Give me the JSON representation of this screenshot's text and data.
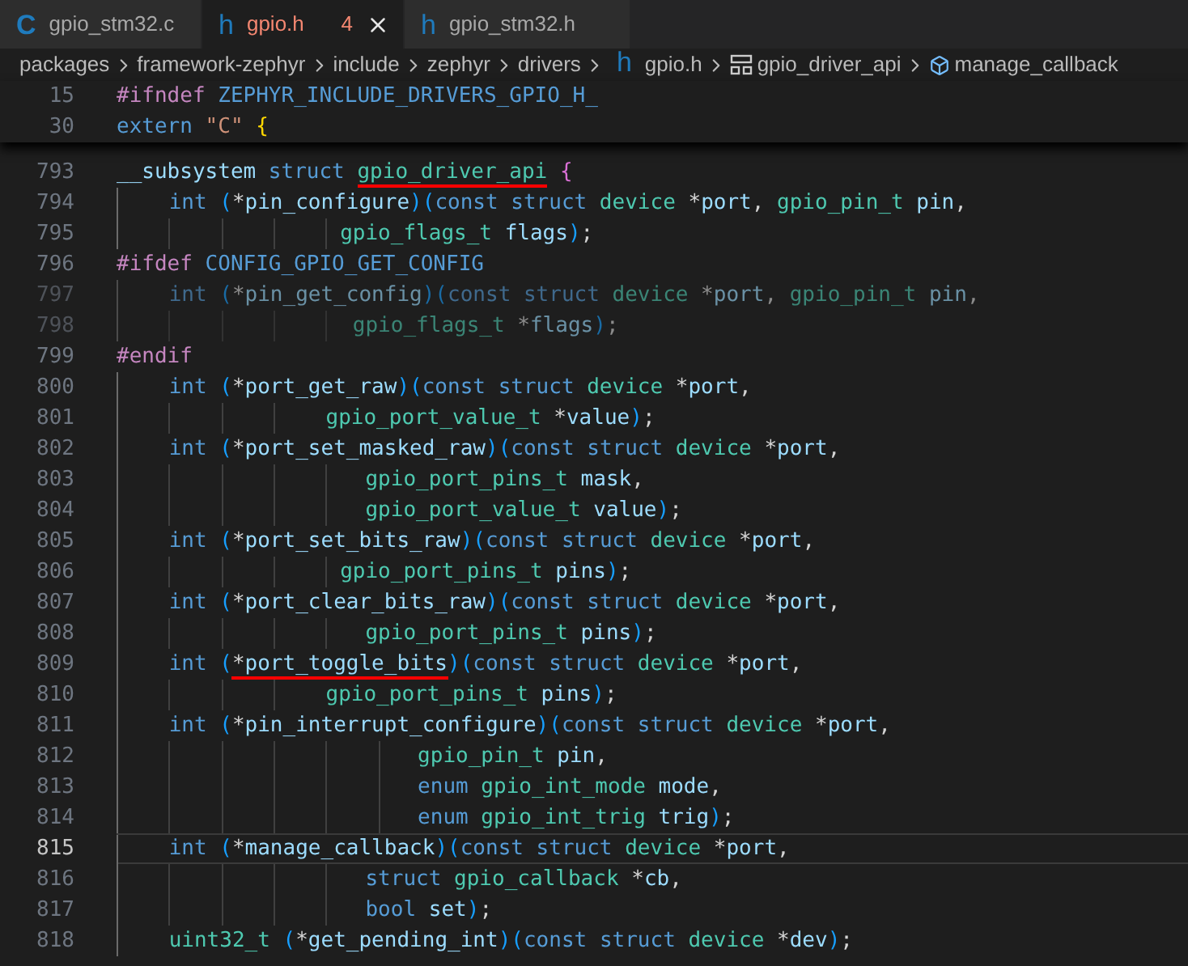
{
  "tabs": [
    {
      "glyph": "C",
      "label": "gpio_stm32.c",
      "selected": false,
      "has_errors": false
    },
    {
      "glyph": "h",
      "label": "gpio.h",
      "problems": "4",
      "selected": true,
      "has_errors": true
    },
    {
      "glyph": "h",
      "label": "gpio_stm32.h",
      "selected": false,
      "has_errors": false
    }
  ],
  "breadcrumb": [
    {
      "kind": "folder",
      "label": "packages"
    },
    {
      "kind": "folder",
      "label": "framework-zephyr"
    },
    {
      "kind": "folder",
      "label": "include"
    },
    {
      "kind": "folder",
      "label": "zephyr"
    },
    {
      "kind": "folder",
      "label": "drivers"
    },
    {
      "kind": "file",
      "glyph": "h",
      "label": "gpio.h"
    },
    {
      "kind": "struct",
      "label": "gpio_driver_api"
    },
    {
      "kind": "field",
      "label": "manage_callback"
    }
  ],
  "sticky_lines": [
    {
      "number": "15",
      "tokens": [
        {
          "text": "#ifndef",
          "kind": "pre"
        },
        {
          "text": " ZEPHYR_INCLUDE_DRIVERS_GPIO_H_",
          "kind": "macro"
        }
      ]
    },
    {
      "number": "30",
      "tokens": [
        {
          "text": "extern",
          "kind": "kw"
        },
        {
          "text": " \"C\"",
          "kind": "str"
        },
        {
          "text": " {",
          "kind": "br1"
        }
      ]
    }
  ],
  "lines": [
    {
      "number": "793",
      "current": false,
      "inactive": false,
      "tokens": [
        {
          "text": "__subsystem",
          "kind": "var"
        },
        {
          "text": " struct ",
          "kind": "kw"
        },
        {
          "text": "gpio_driver_api",
          "kind": "type",
          "underlined": true
        },
        {
          "text": " {",
          "kind": "br2"
        }
      ]
    },
    {
      "number": "794",
      "current": false,
      "inactive": false,
      "tokens": [
        {
          "text": "    int",
          "kind": "kw"
        },
        {
          "text": " (",
          "kind": "br3"
        },
        {
          "text": "*",
          "kind": "p"
        },
        {
          "text": "pin_configure",
          "kind": "var"
        },
        {
          "text": ")(",
          "kind": "br3"
        },
        {
          "text": "const struct",
          "kind": "kw"
        },
        {
          "text": " device",
          "kind": "type"
        },
        {
          "text": " *",
          "kind": "p"
        },
        {
          "text": "port",
          "kind": "var"
        },
        {
          "text": ",",
          "kind": "p"
        },
        {
          "text": " gpio_pin_t",
          "kind": "type"
        },
        {
          "text": " pin",
          "kind": "var"
        },
        {
          "text": ",",
          "kind": "p"
        }
      ]
    },
    {
      "number": "795",
      "current": false,
      "inactive": false,
      "tokens": [
        {
          "text": "                 gpio_flags_t",
          "kind": "type"
        },
        {
          "text": " flags",
          "kind": "var"
        },
        {
          "text": ")",
          "kind": "br3"
        },
        {
          "text": ";",
          "kind": "p"
        }
      ]
    },
    {
      "number": "796",
      "current": false,
      "inactive": false,
      "tokens": [
        {
          "text": "#ifdef",
          "kind": "pre"
        },
        {
          "text": " CONFIG_GPIO_GET_CONFIG",
          "kind": "macro"
        }
      ]
    },
    {
      "number": "797",
      "current": false,
      "inactive": true,
      "tokens": [
        {
          "text": "    int",
          "kind": "kw"
        },
        {
          "text": " (",
          "kind": "br3"
        },
        {
          "text": "*",
          "kind": "p"
        },
        {
          "text": "pin_get_config",
          "kind": "var"
        },
        {
          "text": ")(",
          "kind": "br3"
        },
        {
          "text": "const struct",
          "kind": "kw"
        },
        {
          "text": " device",
          "kind": "type"
        },
        {
          "text": " *",
          "kind": "p"
        },
        {
          "text": "port",
          "kind": "var"
        },
        {
          "text": ",",
          "kind": "p"
        },
        {
          "text": " gpio_pin_t",
          "kind": "type"
        },
        {
          "text": " pin",
          "kind": "var"
        },
        {
          "text": ",",
          "kind": "p"
        }
      ]
    },
    {
      "number": "798",
      "current": false,
      "inactive": true,
      "tokens": [
        {
          "text": "                  gpio_flags_t",
          "kind": "type"
        },
        {
          "text": " *",
          "kind": "p"
        },
        {
          "text": "flags",
          "kind": "var"
        },
        {
          "text": ")",
          "kind": "br3"
        },
        {
          "text": ";",
          "kind": "p"
        }
      ]
    },
    {
      "number": "799",
      "current": false,
      "inactive": false,
      "tokens": [
        {
          "text": "#endif",
          "kind": "pre"
        }
      ]
    },
    {
      "number": "800",
      "current": false,
      "inactive": false,
      "tokens": [
        {
          "text": "    int",
          "kind": "kw"
        },
        {
          "text": " (",
          "kind": "br3"
        },
        {
          "text": "*",
          "kind": "p"
        },
        {
          "text": "port_get_raw",
          "kind": "var"
        },
        {
          "text": ")(",
          "kind": "br3"
        },
        {
          "text": "const struct",
          "kind": "kw"
        },
        {
          "text": " device",
          "kind": "type"
        },
        {
          "text": " *",
          "kind": "p"
        },
        {
          "text": "port",
          "kind": "var"
        },
        {
          "text": ",",
          "kind": "p"
        }
      ]
    },
    {
      "number": "801",
      "current": false,
      "inactive": false,
      "tokens": [
        {
          "text": "                gpio_port_value_t",
          "kind": "type"
        },
        {
          "text": " *",
          "kind": "p"
        },
        {
          "text": "value",
          "kind": "var"
        },
        {
          "text": ")",
          "kind": "br3"
        },
        {
          "text": ";",
          "kind": "p"
        }
      ]
    },
    {
      "number": "802",
      "current": false,
      "inactive": false,
      "tokens": [
        {
          "text": "    int",
          "kind": "kw"
        },
        {
          "text": " (",
          "kind": "br3"
        },
        {
          "text": "*",
          "kind": "p"
        },
        {
          "text": "port_set_masked_raw",
          "kind": "var"
        },
        {
          "text": ")(",
          "kind": "br3"
        },
        {
          "text": "const struct",
          "kind": "kw"
        },
        {
          "text": " device",
          "kind": "type"
        },
        {
          "text": " *",
          "kind": "p"
        },
        {
          "text": "port",
          "kind": "var"
        },
        {
          "text": ",",
          "kind": "p"
        }
      ]
    },
    {
      "number": "803",
      "current": false,
      "inactive": false,
      "tokens": [
        {
          "text": "                   gpio_port_pins_t",
          "kind": "type"
        },
        {
          "text": " mask",
          "kind": "var"
        },
        {
          "text": ",",
          "kind": "p"
        }
      ]
    },
    {
      "number": "804",
      "current": false,
      "inactive": false,
      "tokens": [
        {
          "text": "                   gpio_port_value_t",
          "kind": "type"
        },
        {
          "text": " value",
          "kind": "var"
        },
        {
          "text": ")",
          "kind": "br3"
        },
        {
          "text": ";",
          "kind": "p"
        }
      ]
    },
    {
      "number": "805",
      "current": false,
      "inactive": false,
      "tokens": [
        {
          "text": "    int",
          "kind": "kw"
        },
        {
          "text": " (",
          "kind": "br3"
        },
        {
          "text": "*",
          "kind": "p"
        },
        {
          "text": "port_set_bits_raw",
          "kind": "var"
        },
        {
          "text": ")(",
          "kind": "br3"
        },
        {
          "text": "const struct",
          "kind": "kw"
        },
        {
          "text": " device",
          "kind": "type"
        },
        {
          "text": " *",
          "kind": "p"
        },
        {
          "text": "port",
          "kind": "var"
        },
        {
          "text": ",",
          "kind": "p"
        }
      ]
    },
    {
      "number": "806",
      "current": false,
      "inactive": false,
      "tokens": [
        {
          "text": "                 gpio_port_pins_t",
          "kind": "type"
        },
        {
          "text": " pins",
          "kind": "var"
        },
        {
          "text": ")",
          "kind": "br3"
        },
        {
          "text": ";",
          "kind": "p"
        }
      ]
    },
    {
      "number": "807",
      "current": false,
      "inactive": false,
      "tokens": [
        {
          "text": "    int",
          "kind": "kw"
        },
        {
          "text": " (",
          "kind": "br3"
        },
        {
          "text": "*",
          "kind": "p"
        },
        {
          "text": "port_clear_bits_raw",
          "kind": "var"
        },
        {
          "text": ")(",
          "kind": "br3"
        },
        {
          "text": "const struct",
          "kind": "kw"
        },
        {
          "text": " device",
          "kind": "type"
        },
        {
          "text": " *",
          "kind": "p"
        },
        {
          "text": "port",
          "kind": "var"
        },
        {
          "text": ",",
          "kind": "p"
        }
      ]
    },
    {
      "number": "808",
      "current": false,
      "inactive": false,
      "tokens": [
        {
          "text": "                   gpio_port_pins_t",
          "kind": "type"
        },
        {
          "text": " pins",
          "kind": "var"
        },
        {
          "text": ")",
          "kind": "br3"
        },
        {
          "text": ";",
          "kind": "p"
        }
      ]
    },
    {
      "number": "809",
      "current": false,
      "inactive": false,
      "tokens": [
        {
          "text": "    int",
          "kind": "kw"
        },
        {
          "text": " (",
          "kind": "br3"
        },
        {
          "text": "*",
          "kind": "p",
          "underlined": true
        },
        {
          "text": "port_toggle_bits",
          "kind": "var",
          "underlined": true
        },
        {
          "text": ")(",
          "kind": "br3"
        },
        {
          "text": "const struct",
          "kind": "kw"
        },
        {
          "text": " device",
          "kind": "type"
        },
        {
          "text": " *",
          "kind": "p"
        },
        {
          "text": "port",
          "kind": "var"
        },
        {
          "text": ",",
          "kind": "p"
        }
      ]
    },
    {
      "number": "810",
      "current": false,
      "inactive": false,
      "tokens": [
        {
          "text": "                gpio_port_pins_t",
          "kind": "type"
        },
        {
          "text": " pins",
          "kind": "var"
        },
        {
          "text": ")",
          "kind": "br3"
        },
        {
          "text": ";",
          "kind": "p"
        }
      ]
    },
    {
      "number": "811",
      "current": false,
      "inactive": false,
      "tokens": [
        {
          "text": "    int",
          "kind": "kw"
        },
        {
          "text": " (",
          "kind": "br3"
        },
        {
          "text": "*",
          "kind": "p"
        },
        {
          "text": "pin_interrupt_configure",
          "kind": "var"
        },
        {
          "text": ")(",
          "kind": "br3"
        },
        {
          "text": "const struct",
          "kind": "kw"
        },
        {
          "text": " device",
          "kind": "type"
        },
        {
          "text": " *",
          "kind": "p"
        },
        {
          "text": "port",
          "kind": "var"
        },
        {
          "text": ",",
          "kind": "p"
        }
      ]
    },
    {
      "number": "812",
      "current": false,
      "inactive": false,
      "tokens": [
        {
          "text": "                       gpio_pin_t",
          "kind": "type"
        },
        {
          "text": " pin",
          "kind": "var"
        },
        {
          "text": ",",
          "kind": "p"
        }
      ]
    },
    {
      "number": "813",
      "current": false,
      "inactive": false,
      "tokens": [
        {
          "text": "                       enum",
          "kind": "kw"
        },
        {
          "text": " gpio_int_mode",
          "kind": "type"
        },
        {
          "text": " mode",
          "kind": "var"
        },
        {
          "text": ",",
          "kind": "p"
        }
      ]
    },
    {
      "number": "814",
      "current": false,
      "inactive": false,
      "tokens": [
        {
          "text": "                       enum",
          "kind": "kw"
        },
        {
          "text": " gpio_int_trig",
          "kind": "type"
        },
        {
          "text": " trig",
          "kind": "var"
        },
        {
          "text": ")",
          "kind": "br3"
        },
        {
          "text": ";",
          "kind": "p"
        }
      ]
    },
    {
      "number": "815",
      "current": true,
      "inactive": false,
      "tokens": [
        {
          "text": "    int",
          "kind": "kw"
        },
        {
          "text": " (",
          "kind": "br3"
        },
        {
          "text": "*",
          "kind": "p"
        },
        {
          "text": "manage_callback",
          "kind": "var"
        },
        {
          "text": ")(",
          "kind": "br3"
        },
        {
          "text": "const struct",
          "kind": "kw"
        },
        {
          "text": " device",
          "kind": "type"
        },
        {
          "text": " *",
          "kind": "p"
        },
        {
          "text": "port",
          "kind": "var"
        },
        {
          "text": ",",
          "kind": "p"
        }
      ]
    },
    {
      "number": "816",
      "current": false,
      "inactive": false,
      "tokens": [
        {
          "text": "                   struct",
          "kind": "kw"
        },
        {
          "text": " gpio_callback",
          "kind": "type"
        },
        {
          "text": " *",
          "kind": "p"
        },
        {
          "text": "cb",
          "kind": "var"
        },
        {
          "text": ",",
          "kind": "p"
        }
      ]
    },
    {
      "number": "817",
      "current": false,
      "inactive": false,
      "tokens": [
        {
          "text": "                   bool",
          "kind": "kw"
        },
        {
          "text": " set",
          "kind": "var"
        },
        {
          "text": ")",
          "kind": "br3"
        },
        {
          "text": ";",
          "kind": "p"
        }
      ]
    },
    {
      "number": "818",
      "current": false,
      "inactive": false,
      "tokens": [
        {
          "text": "    uint32_t",
          "kind": "type"
        },
        {
          "text": " (",
          "kind": "br3"
        },
        {
          "text": "*",
          "kind": "p"
        },
        {
          "text": "get_pending_int",
          "kind": "var"
        },
        {
          "text": ")(",
          "kind": "br3"
        },
        {
          "text": "const struct",
          "kind": "kw"
        },
        {
          "text": " device",
          "kind": "type"
        },
        {
          "text": " *",
          "kind": "p"
        },
        {
          "text": "dev",
          "kind": "var"
        },
        {
          "text": ")",
          "kind": "br3"
        },
        {
          "text": ";",
          "kind": "p"
        }
      ]
    }
  ]
}
